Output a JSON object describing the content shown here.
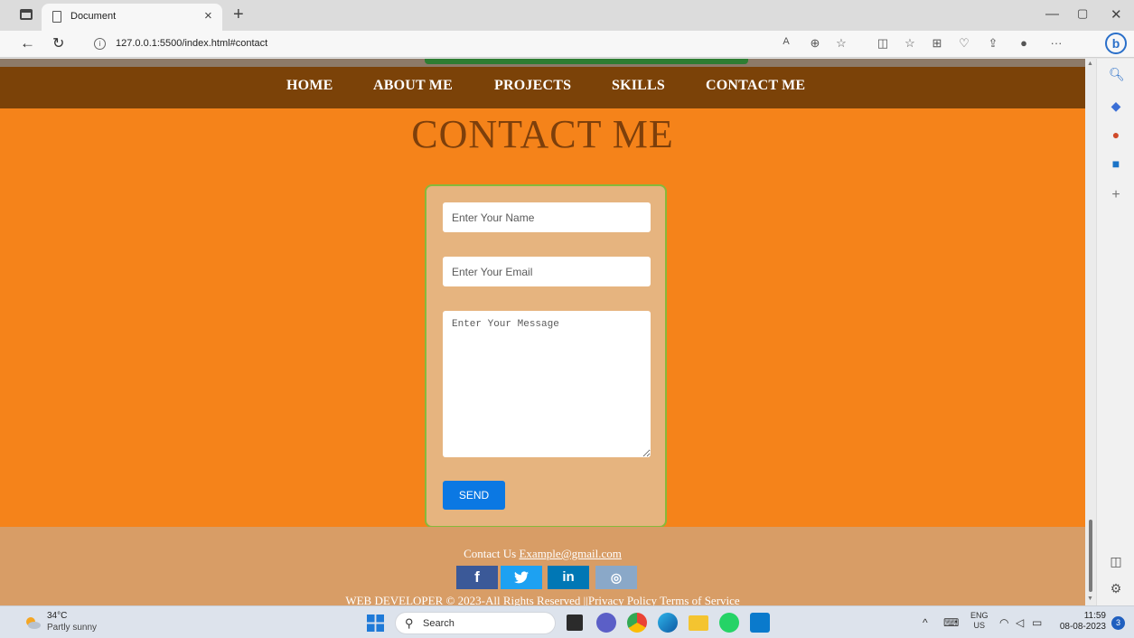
{
  "browser": {
    "tab_title": "Document",
    "tab_close": "×",
    "new_tab": "+",
    "url": "127.0.0.1:5500/index.html#contact",
    "toolbar_icons": [
      "read-aloud-icon",
      "zoom-icon",
      "favorite-star-icon",
      "split-screen-icon",
      "favorites-icon",
      "collections-icon",
      "browser-essentials-icon",
      "share-icon",
      "profile-icon",
      "more-icon"
    ],
    "more_label": "···"
  },
  "nav": {
    "items": [
      "HOME",
      "ABOUT ME",
      "PROJECTS",
      "SKILLS",
      "CONTACT ME"
    ]
  },
  "contact": {
    "title": "CONTACT ME",
    "name_placeholder": "Enter Your Name",
    "email_placeholder": "Enter Your Email",
    "message_placeholder": "Enter Your Message",
    "send_label": "SEND"
  },
  "footer": {
    "contact_prefix": "Contact Us",
    "contact_email": "Example@gmail.com",
    "copyright": "WEB DEVELOPER © 2023-All Rights Reserved ||Privacy Policy Terms of Service",
    "socials": [
      {
        "name": "facebook-icon",
        "glyph": "f",
        "color": "#3b5998"
      },
      {
        "name": "twitter-icon",
        "glyph": "🐦",
        "color": "#1da1f2"
      },
      {
        "name": "linkedin-icon",
        "glyph": "in",
        "color": "#0077b5"
      },
      {
        "name": "instagram-icon",
        "glyph": "◎",
        "color": "#8aa8c8"
      }
    ]
  },
  "taskbar": {
    "weather_temp": "34°C",
    "weather_desc": "Partly sunny",
    "search_label": "Search",
    "lang_line1": "ENG",
    "lang_line2": "US",
    "time": "11:59",
    "date": "08-08-2023",
    "notification_count": "3"
  },
  "colors": {
    "page_bg": "#f5831a",
    "navbar": "#7b4208",
    "title": "#7d3f0b",
    "form_bg": "#e6b47f",
    "form_border": "#86b93b",
    "send_button": "#0b78e3",
    "footer": "#d89d66"
  }
}
